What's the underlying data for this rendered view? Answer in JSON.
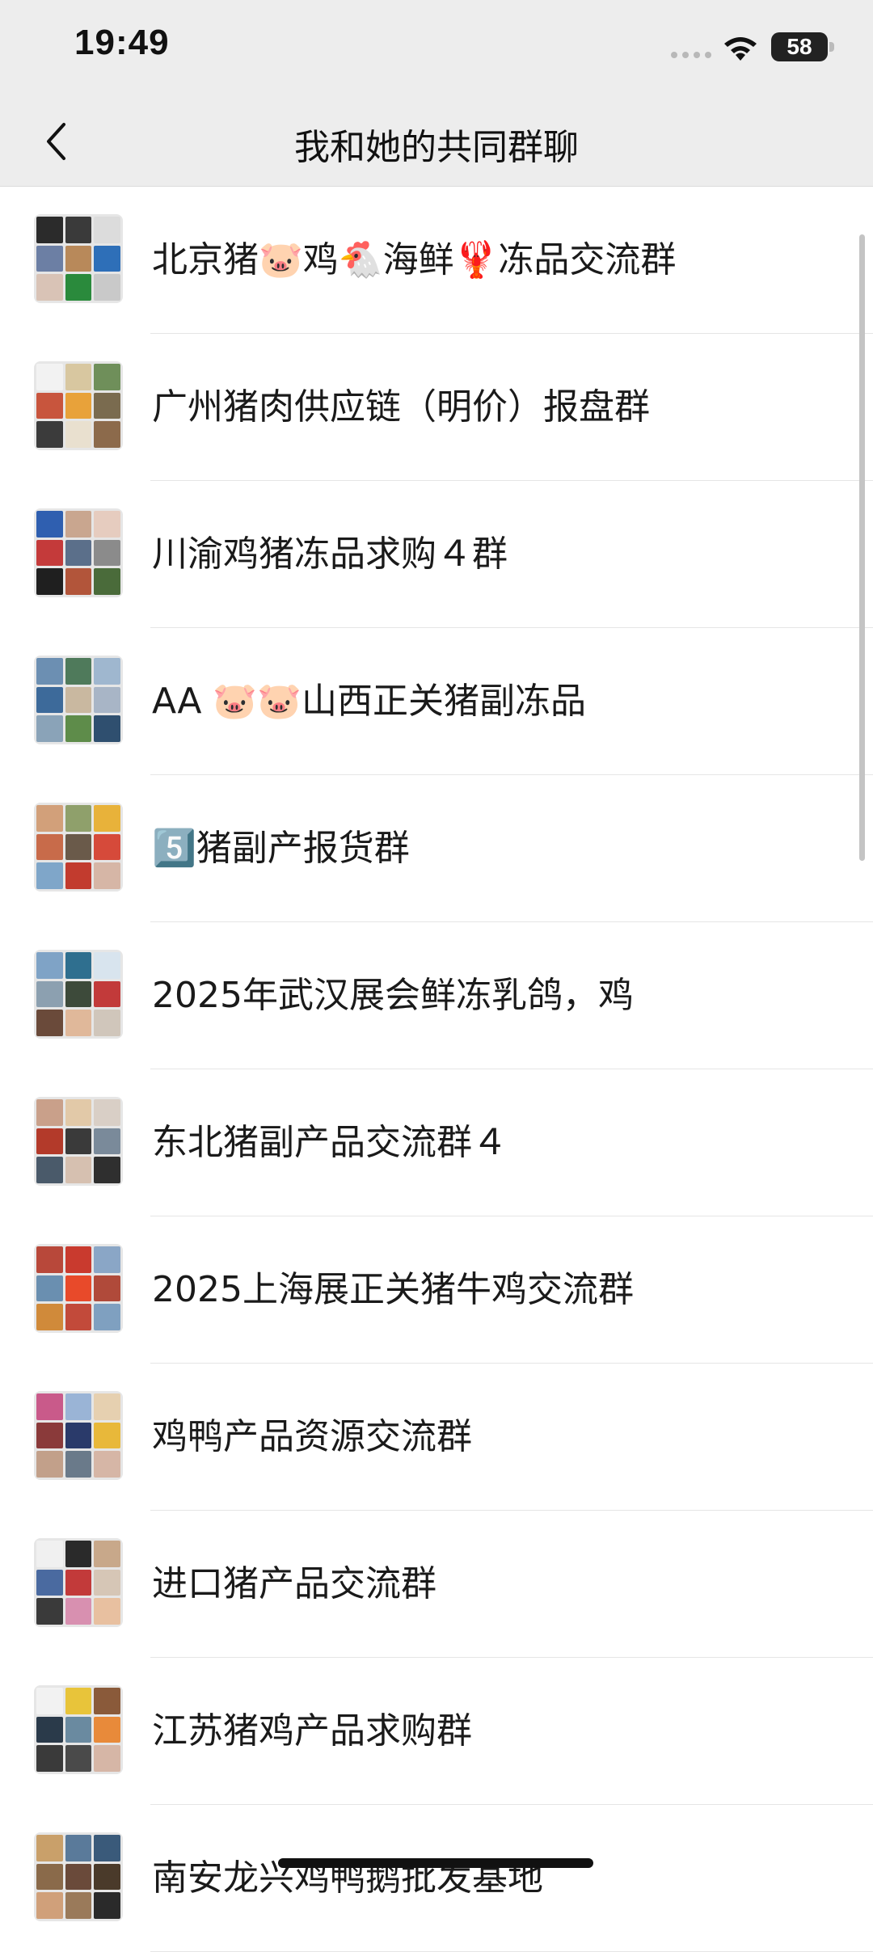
{
  "status_bar": {
    "time": "19:49",
    "battery": "58",
    "icons": [
      "signal-dots-icon",
      "wifi-icon",
      "battery-icon"
    ]
  },
  "nav": {
    "title": "我和她的共同群聊",
    "back_icon": "chevron-left-icon"
  },
  "groups": [
    {
      "name": "北京猪🐷鸡🐔海鲜🦞冻品交流群",
      "colors": [
        "#2b2b2b",
        "#3a3a3a",
        "#dcdcdc",
        "#6c7fa4",
        "#b8895a",
        "#2e6fb8",
        "#d9c3b6",
        "#2a8a3c",
        "#c9c9c9"
      ]
    },
    {
      "name": "广州猪肉供应链（明价）报盘群",
      "colors": [
        "#f2f2f2",
        "#d8c7a0",
        "#6f8f5a",
        "#c8553d",
        "#e8a23a",
        "#7a6b4f",
        "#3b3b3b",
        "#e9e0cf",
        "#8c6a4b"
      ]
    },
    {
      "name": "川渝鸡猪冻品求购４群",
      "colors": [
        "#2f5fb0",
        "#c9a68f",
        "#e6ccbf",
        "#c43a3a",
        "#5b6f8a",
        "#8b8b8b",
        "#1f1f1f",
        "#b2553a",
        "#4a6b3a"
      ]
    },
    {
      "name": "AA 🐷🐷山西正关猪副冻品",
      "colors": [
        "#6c8fb2",
        "#4f7a5b",
        "#9fb7cf",
        "#3d6a9a",
        "#c9b8a0",
        "#a8b5c6",
        "#8aa3b8",
        "#5e8c4a",
        "#2f4f6f"
      ]
    },
    {
      "name": "5️⃣猪副产报货群",
      "colors": [
        "#d2a07a",
        "#8fa06b",
        "#e8b23a",
        "#c86b4a",
        "#6a5a4a",
        "#d64a3a",
        "#7fa6c9",
        "#c23b2e",
        "#d6b6a6"
      ]
    },
    {
      "name": "2025年武汉展会鲜冻乳鸽，鸡",
      "colors": [
        "#7fa3c6",
        "#2f6f8f",
        "#d8e4ee",
        "#8ca0b0",
        "#3d4a3a",
        "#c23a3a",
        "#6a4a3a",
        "#e0b89a",
        "#d0c6bb"
      ]
    },
    {
      "name": "东北猪副产品交流群４",
      "colors": [
        "#c9a08a",
        "#e2c9a8",
        "#d9cfc6",
        "#b33a2a",
        "#3a3a3a",
        "#7a8a9a",
        "#4a5a6a",
        "#d6c0b0",
        "#2f2f2f"
      ]
    },
    {
      "name": "2025上海展正关猪牛鸡交流群",
      "colors": [
        "#b8483a",
        "#c93a2e",
        "#8aa6c6",
        "#6a8fb0",
        "#e84a2a",
        "#b04a3a",
        "#d08a3a",
        "#c24a3a",
        "#7fa0c0"
      ]
    },
    {
      "name": "鸡鸭产品资源交流群",
      "colors": [
        "#c95a8a",
        "#9ab4d6",
        "#e6d0b0",
        "#8a3a3a",
        "#2a3a6a",
        "#e8b83a",
        "#c2a08a",
        "#6a7a8a",
        "#d6b6a6"
      ]
    },
    {
      "name": "进口猪产品交流群",
      "colors": [
        "#f0f0f0",
        "#2a2a2a",
        "#c8a88a",
        "#4a6aa0",
        "#c23a3a",
        "#d6c6b6",
        "#3a3a3a",
        "#d890b0",
        "#e8c0a0"
      ]
    },
    {
      "name": "江苏猪鸡产品求购群",
      "colors": [
        "#f2f2f2",
        "#e8c43a",
        "#8a5a3a",
        "#2a3a4a",
        "#6a8aa0",
        "#e88a3a",
        "#3a3a3a",
        "#4a4a4a",
        "#d6b6a6"
      ]
    },
    {
      "name": "南安龙兴鸡鸭鹅批发基地",
      "colors": [
        "#c9a06a",
        "#5a7a9a",
        "#3a5a7a",
        "#8a6a4a",
        "#6a4a3a",
        "#4a3a2a",
        "#d0a07a",
        "#9a7a5a",
        "#2a2a2a"
      ]
    }
  ]
}
